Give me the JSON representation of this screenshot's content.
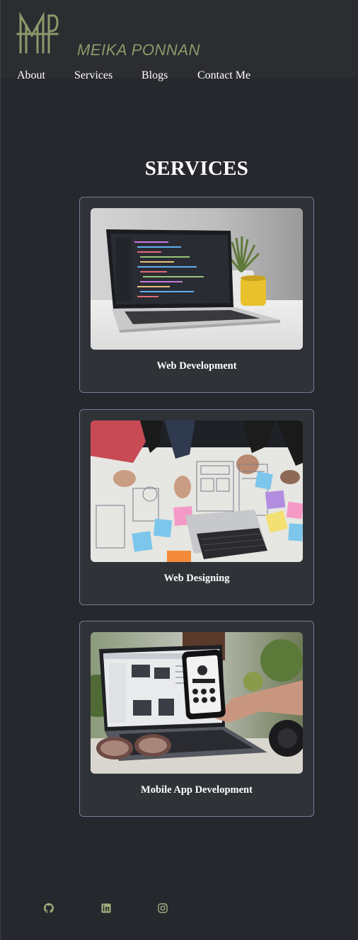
{
  "header": {
    "brand_name": "MEIKA PONNAN",
    "logo_icon": "mp-monogram-logo",
    "nav": [
      {
        "label": "About"
      },
      {
        "label": "Services"
      },
      {
        "label": "Blogs"
      },
      {
        "label": "Contact Me"
      }
    ]
  },
  "services": {
    "title": "SERVICES",
    "cards": [
      {
        "label": "Web Development",
        "image": "laptop-with-code-photo"
      },
      {
        "label": "Web Designing",
        "image": "wireframe-sketching-photo"
      },
      {
        "label": "Mobile App Development",
        "image": "laptop-and-phone-photo"
      }
    ]
  },
  "footer": {
    "icons": [
      "github-icon",
      "linkedin-icon",
      "instagram-icon"
    ]
  },
  "colors": {
    "background": "#26282d",
    "card_background": "#2f3237",
    "card_border": "#7b7896",
    "brand_accent": "#8a9a6a",
    "footer_icon": "#a3ad7d"
  }
}
